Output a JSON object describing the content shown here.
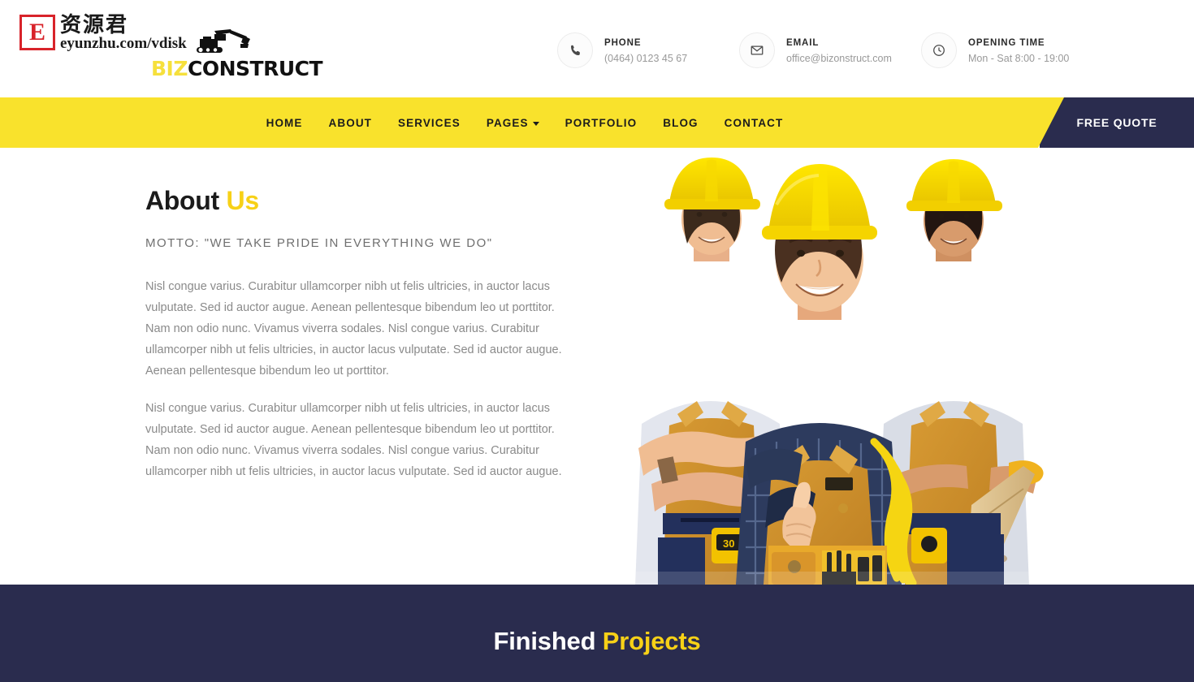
{
  "colors": {
    "accent_yellow": "#f9e22c",
    "title_yellow": "#f7d117",
    "navy": "#2a2c4e",
    "body_text": "#8a8a8a",
    "heading": "#1b1b1b",
    "watermark_red": "#d8232a"
  },
  "watermark": {
    "badge_letter": "E",
    "chinese": "资源君",
    "url": "eyunzhu.com/vdisk"
  },
  "brand": {
    "part1": "BIZ",
    "part2": "CONSTRUCT",
    "icon": "excavator-icon"
  },
  "header": {
    "contacts": [
      {
        "icon": "phone-icon",
        "label": "PHONE",
        "value": "(0464) 0123 45 67"
      },
      {
        "icon": "envelope-icon",
        "label": "EMAIL",
        "value": "office@bizonstruct.com"
      },
      {
        "icon": "clock-icon",
        "label": "OPENING TIME",
        "value": "Mon - Sat 8:00 - 19:00"
      }
    ]
  },
  "nav": {
    "items": [
      {
        "label": "HOME",
        "has_dropdown": false
      },
      {
        "label": "ABOUT",
        "has_dropdown": false
      },
      {
        "label": "SERVICES",
        "has_dropdown": false
      },
      {
        "label": "PAGES",
        "has_dropdown": true
      },
      {
        "label": "PORTFOLIO",
        "has_dropdown": false
      },
      {
        "label": "BLOG",
        "has_dropdown": false
      },
      {
        "label": "CONTACT",
        "has_dropdown": false
      }
    ],
    "cta_label": "FREE QUOTE"
  },
  "about": {
    "title_dark": "About",
    "title_accent": "Us",
    "motto": "MOTTO: \"WE TAKE PRIDE IN EVERYTHING WE DO\"",
    "paragraph1": "Nisl congue varius. Curabitur ullamcorper nibh ut felis ultricies, in auctor lacus vulputate. Sed id auctor augue. Aenean pellentesque bibendum leo ut porttitor. Nam non odio nunc. Vivamus viverra sodales. Nisl congue varius. Curabitur ullamcorper nibh ut felis ultricies, in auctor lacus vulputate. Sed id auctor augue. Aenean pellentesque bibendum leo ut porttitor.",
    "paragraph2": "Nisl congue varius. Curabitur ullamcorper nibh ut felis ultricies, in auctor lacus vulputate. Sed id auctor augue. Aenean pellentesque bibendum leo ut porttitor. Nam non odio nunc. Vivamus viverra sodales. Nisl congue varius. Curabitur ullamcorper nibh ut felis ultricies, in auctor lacus vulputate. Sed id auctor augue.",
    "photo_alt": "three-construction-workers-photo"
  },
  "projects": {
    "title_white": "Finished",
    "title_accent": "Projects"
  }
}
